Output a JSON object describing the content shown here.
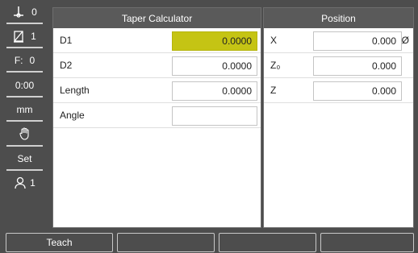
{
  "sidebar": {
    "datum": {
      "icon": "datum-icon",
      "value": "0"
    },
    "tool": {
      "icon": "tool-icon",
      "value": "1"
    },
    "feed": {
      "label": "F:",
      "value": "0"
    },
    "timer": {
      "label": "0:00"
    },
    "unit": {
      "label": "mm"
    },
    "hand": {
      "icon": "hand-icon"
    },
    "set": {
      "label": "Set"
    },
    "user": {
      "icon": "user-icon",
      "value": "1"
    }
  },
  "taper": {
    "title": "Taper Calculator",
    "rows": [
      {
        "label": "D1",
        "value": "0.0000",
        "active": true
      },
      {
        "label": "D2",
        "value": "0.0000",
        "active": false
      },
      {
        "label": "Length",
        "value": "0.0000",
        "active": false
      },
      {
        "label": "Angle",
        "value": "",
        "active": false
      }
    ]
  },
  "position": {
    "title": "Position",
    "rows": [
      {
        "axis": "X",
        "value": "0.000",
        "unit": "Ø"
      },
      {
        "axis": "Z₀",
        "value": "0.000",
        "unit": ""
      },
      {
        "axis": "Z",
        "value": "0.000",
        "unit": ""
      }
    ]
  },
  "softkeys": [
    "Teach",
    "",
    "",
    "",
    ""
  ],
  "colors": {
    "active_field": "#c5c414",
    "header": "#5a5a5a",
    "background": "#4d4d4d"
  }
}
